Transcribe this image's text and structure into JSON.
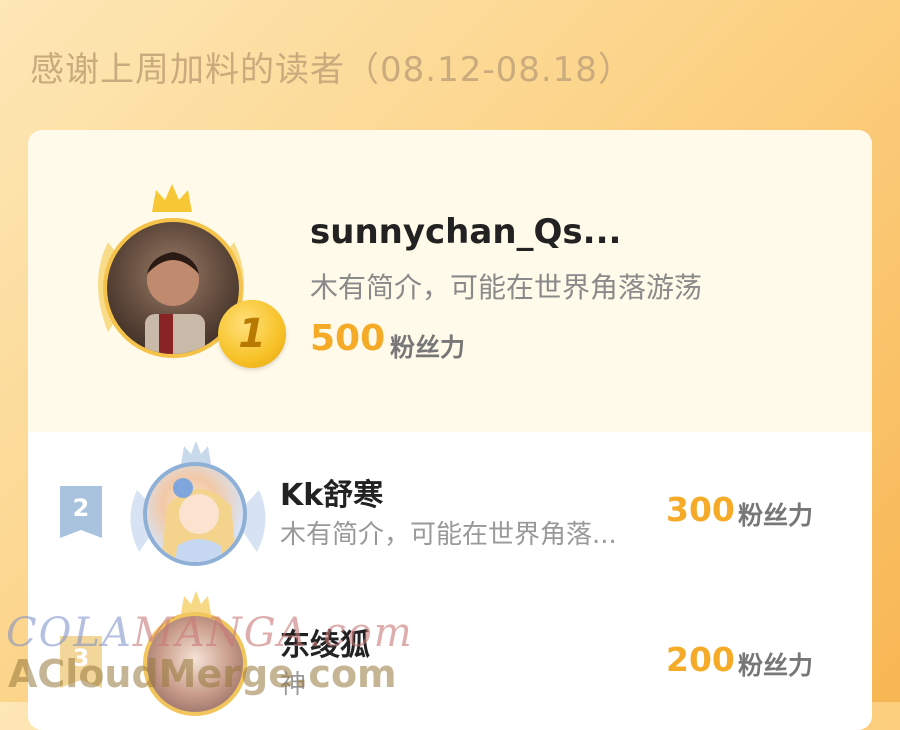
{
  "header": {
    "title": "感谢上周加料的读者（08.12-08.18）"
  },
  "ranking": [
    {
      "rank": "1",
      "name": "sunnychan_Qs...",
      "bio": "木有简介，可能在世界角落游荡",
      "score": "500",
      "unit": "粉丝力"
    },
    {
      "rank": "2",
      "name": "Kk舒寒",
      "bio": "木有简介，可能在世界角落...",
      "score": "300",
      "unit": "粉丝力"
    },
    {
      "rank": "3",
      "name": "东绫狐",
      "bio": "神",
      "score": "200",
      "unit": "粉丝力"
    }
  ],
  "watermark": {
    "line1a": "COLA",
    "line1b": "MANGA.com",
    "line2": "ACloudMerge.com"
  },
  "colors": {
    "accent": "#f5ab27",
    "gold": "#f5c24a",
    "silver": "#8fb0d6"
  }
}
